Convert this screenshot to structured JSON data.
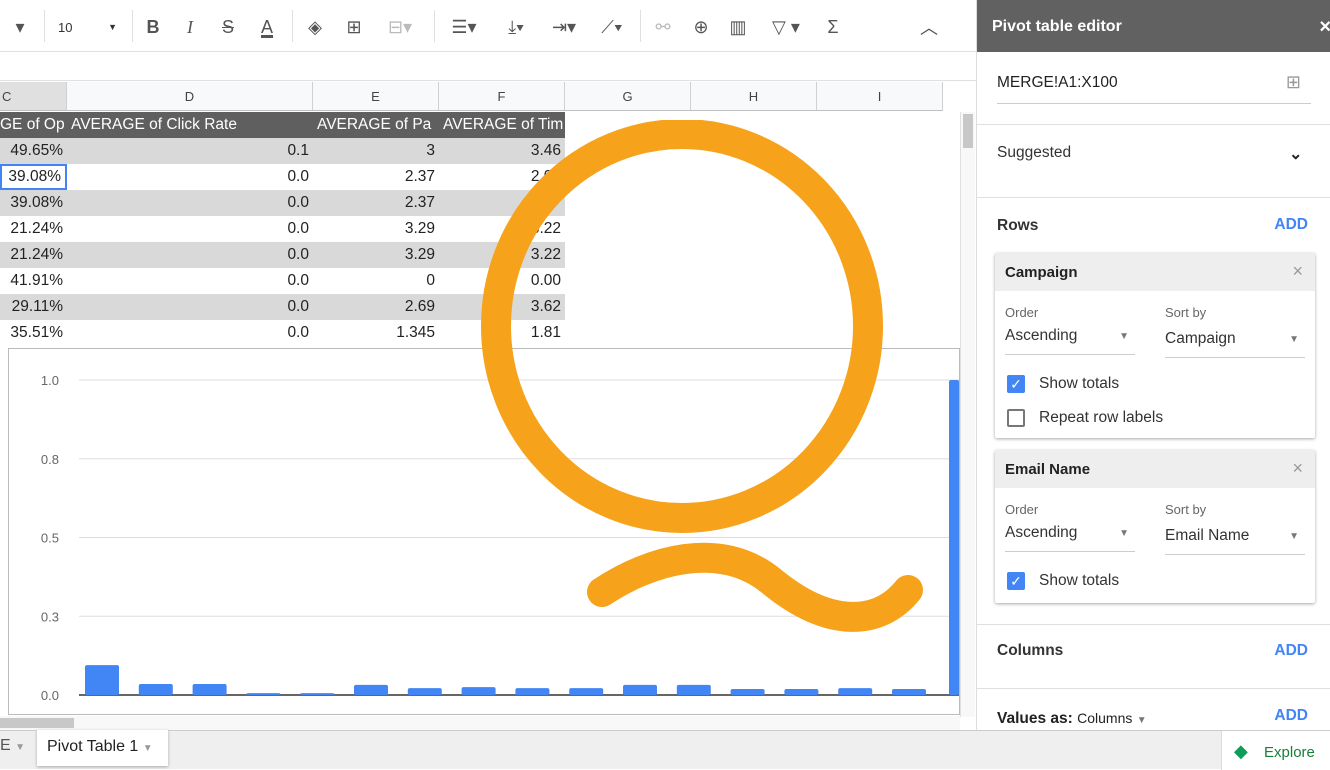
{
  "toolbar": {
    "font_size": "10",
    "icons": [
      "bold-icon",
      "italic-icon",
      "strikethrough-icon",
      "text-color-icon",
      "fill-color-icon",
      "borders-icon",
      "merge-icon",
      "align-icon",
      "valign-icon",
      "wrap-icon",
      "rotate-icon",
      "link-icon",
      "comment-icon",
      "chart-icon",
      "filter-icon",
      "functions-icon",
      "collapse-icon"
    ],
    "bold": "B",
    "italic": "I",
    "strike": "S",
    "textcolor": "A",
    "sigma": "Σ"
  },
  "columns": [
    "C",
    "D",
    "E",
    "F",
    "G",
    "H",
    "I"
  ],
  "table": {
    "headers": [
      "GE of Op",
      "AVERAGE of Click Rate",
      "AVERAGE of Pa",
      "AVERAGE of Tim"
    ],
    "rows": [
      [
        "49.65%",
        "0.1",
        "3",
        "3.46"
      ],
      [
        "39.08%",
        "0.0",
        "2.37",
        "2.09"
      ],
      [
        "39.08%",
        "0.0",
        "2.37",
        ""
      ],
      [
        "21.24%",
        "0.0",
        "3.29",
        "3.22"
      ],
      [
        "21.24%",
        "0.0",
        "3.29",
        "3.22"
      ],
      [
        "41.91%",
        "0.0",
        "0",
        "0.00"
      ],
      [
        "29.11%",
        "0.0",
        "2.69",
        "3.62"
      ],
      [
        "35.51%",
        "0.0",
        "1.345",
        "1.81"
      ]
    ]
  },
  "chart_data": {
    "type": "bar",
    "ylim": [
      0,
      1
    ],
    "yticks": [
      "0.0",
      "0.3",
      "0.5",
      "0.8",
      "1.0"
    ],
    "grid": true,
    "color": "#4285f4",
    "values": [
      0.095,
      0.035,
      0.035,
      0.006,
      0.006,
      0.032,
      0.022,
      0.025,
      0.022,
      0.022,
      0.032,
      0.032,
      0.019,
      0.019,
      0.022,
      0.019,
      1.0
    ]
  },
  "panel": {
    "title": "Pivot table editor",
    "range": "MERGE!A1:X100",
    "suggested": "Suggested",
    "rows_label": "Rows",
    "add": "ADD",
    "cards": [
      {
        "name": "Campaign",
        "order_label": "Order",
        "order": "Ascending",
        "sort_label": "Sort by",
        "sort": "Campaign",
        "show_totals": "Show totals",
        "repeat": "Repeat row labels"
      },
      {
        "name": "Email Name",
        "order_label": "Order",
        "order": "Ascending",
        "sort_label": "Sort by",
        "sort": "Email Name",
        "show_totals": "Show totals"
      }
    ],
    "columns_label": "Columns",
    "values_as_label": "Values as:",
    "values_as": "Columns"
  },
  "tabs": {
    "prev": "E",
    "active": "Pivot Table 1",
    "explore": "Explore"
  },
  "overlay": {
    "color": "#f7a21b"
  }
}
